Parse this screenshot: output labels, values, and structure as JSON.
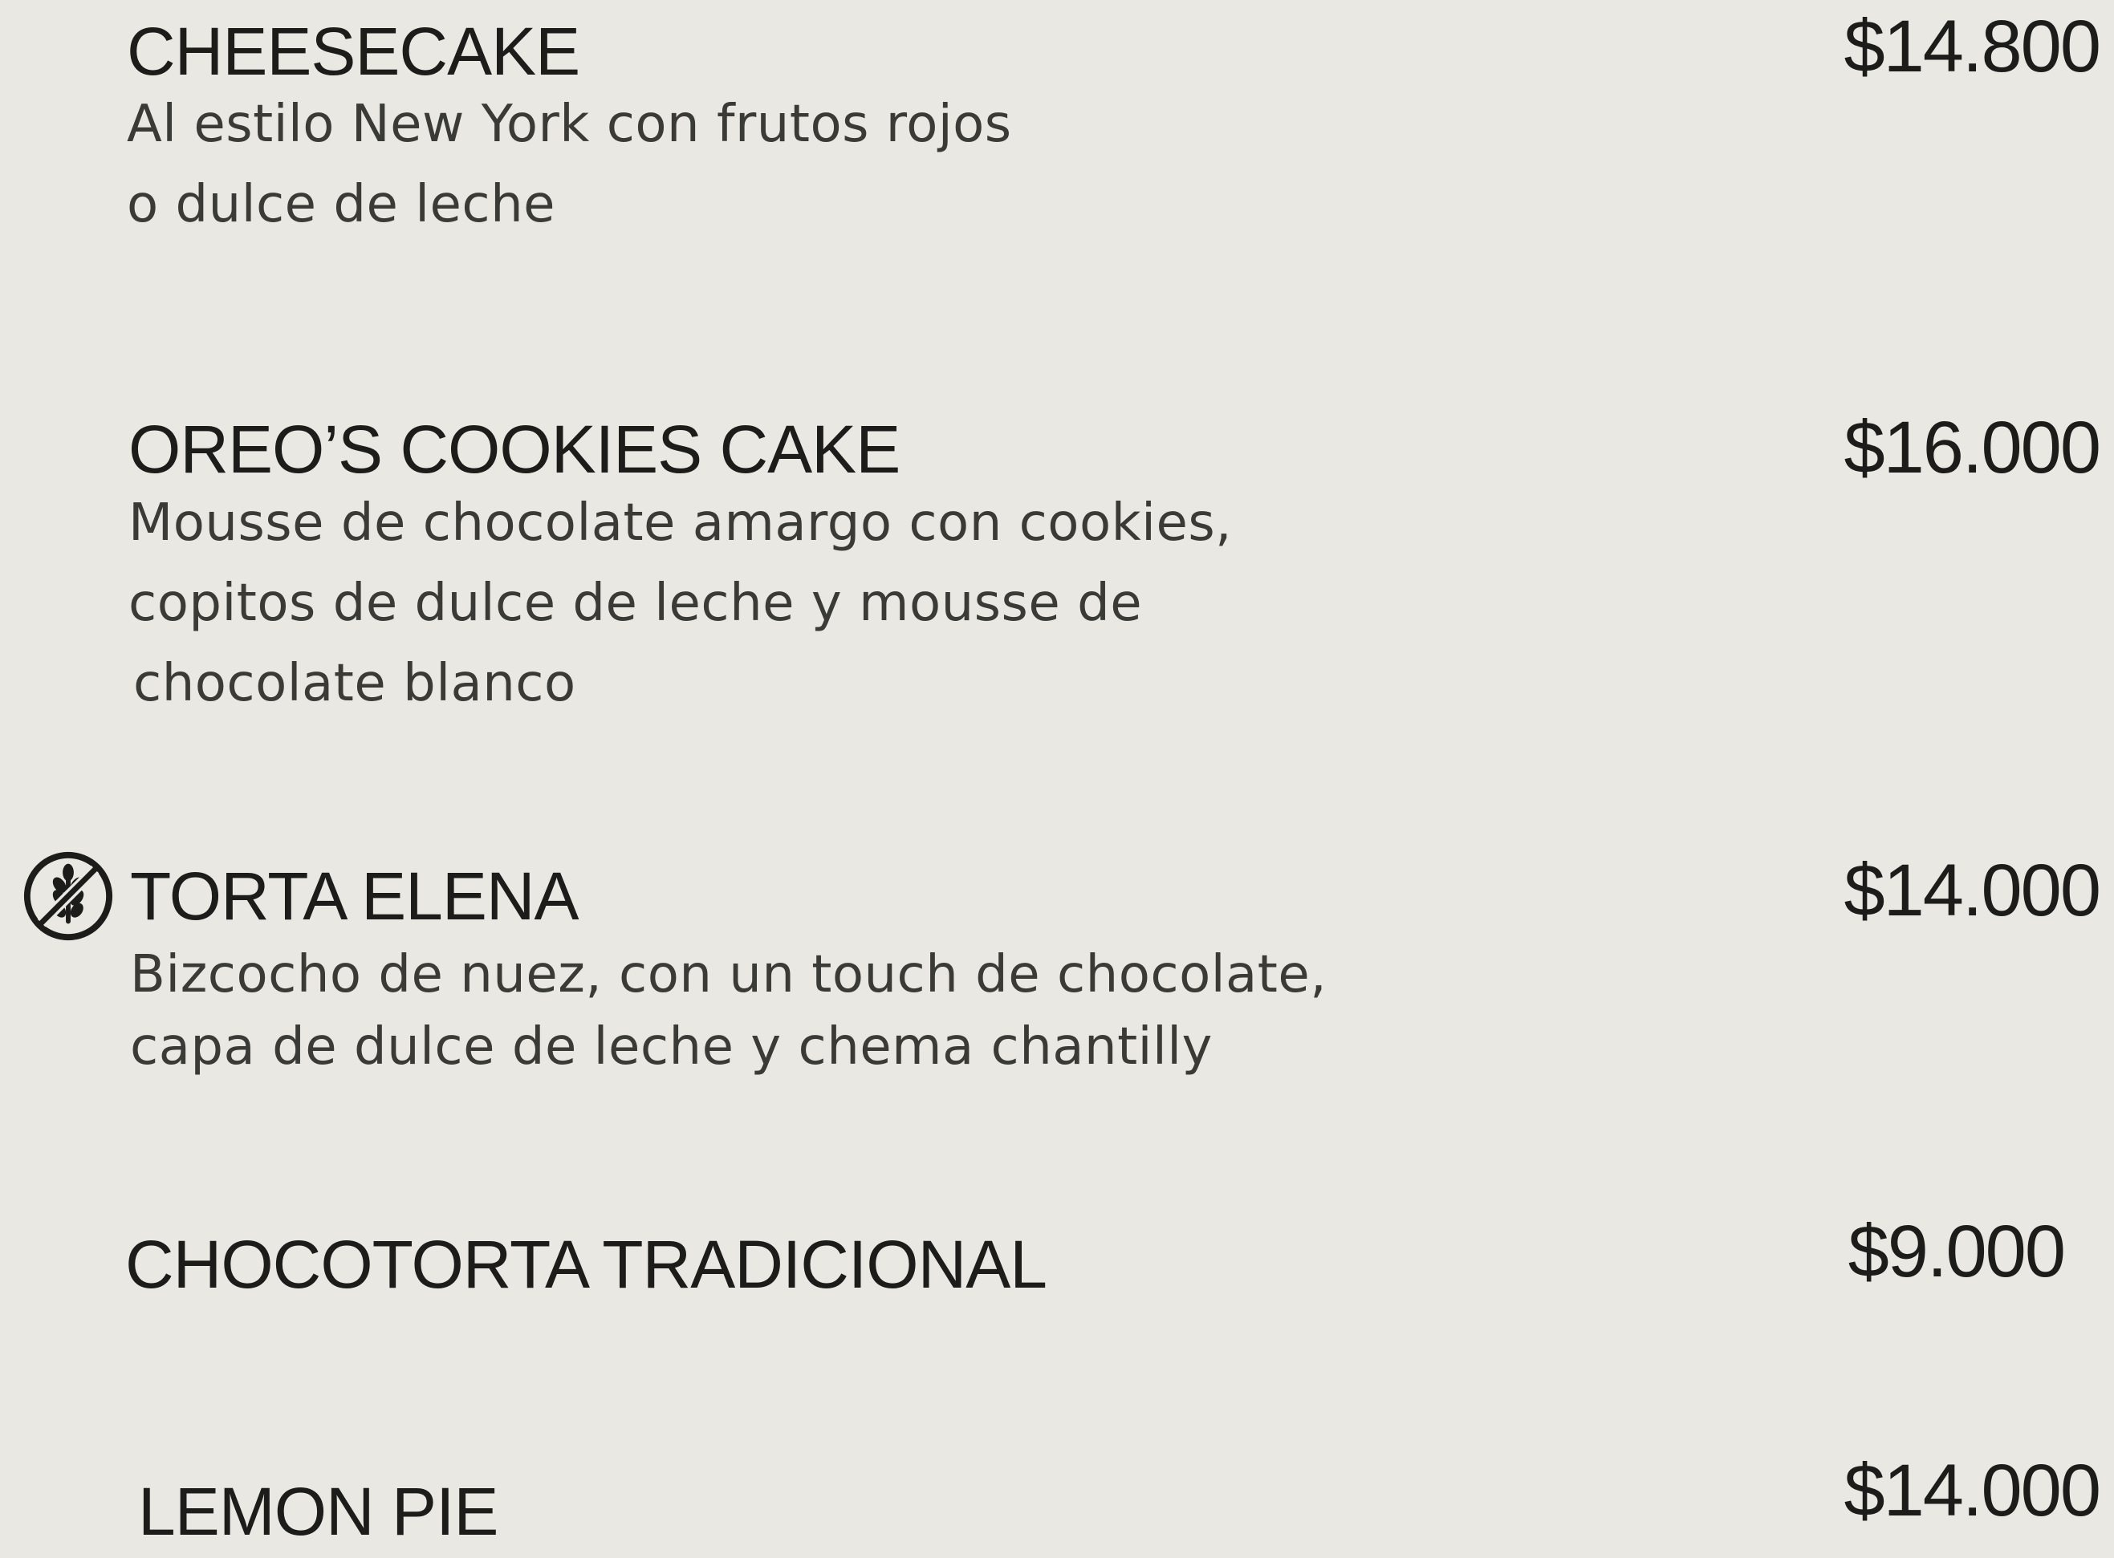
{
  "items": [
    {
      "name": "CHEESECAKE",
      "price": "$14.800",
      "description": [
        "Al estilo New York con frutos rojos",
        "o dulce de leche"
      ]
    },
    {
      "name": "OREO’S COOKIES CAKE",
      "price": "$16.000",
      "description": [
        "Mousse de chocolate amargo con cookies,",
        "copitos de dulce de leche y mousse de",
        "chocolate blanco"
      ]
    },
    {
      "name": "TORTA ELENA",
      "price": "$14.000",
      "icon": "gluten-free-icon",
      "description": [
        "Bizcocho de nuez, con un touch de chocolate,",
        "capa de dulce de leche y chema chantilly"
      ]
    },
    {
      "name": "CHOCOTORTA TRADICIONAL",
      "price": "$9.000",
      "description": []
    },
    {
      "name": "LEMON PIE",
      "price": "$14.000",
      "description": []
    }
  ],
  "colors": {
    "background": "#e9e8e2",
    "text": "#1c1c1a",
    "description": "#3a3a37"
  }
}
